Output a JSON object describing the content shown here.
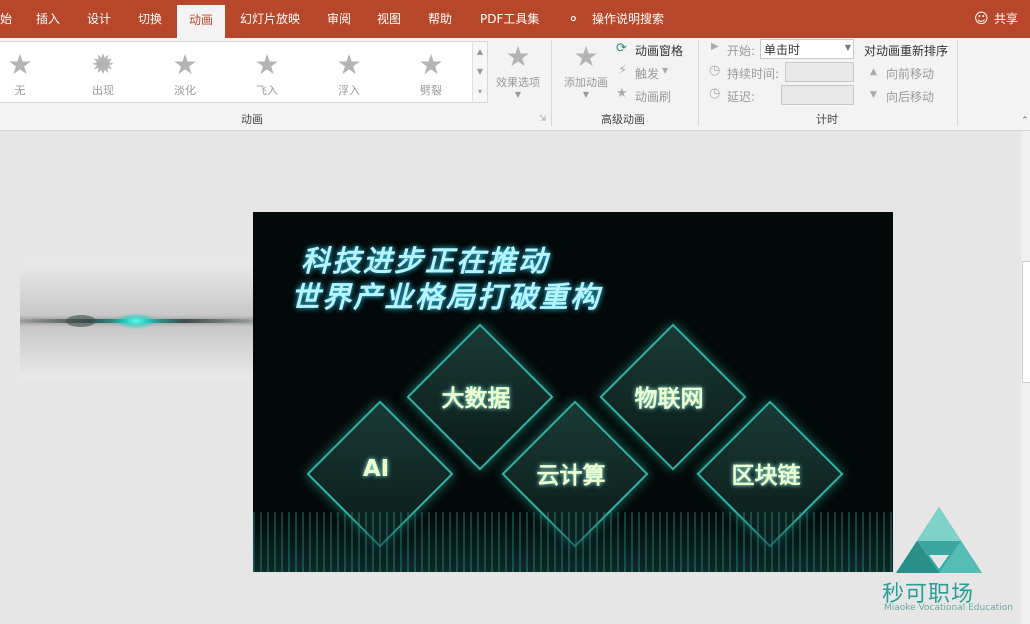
{
  "menu": {
    "items": [
      "始",
      "插入",
      "设计",
      "切换",
      "动画",
      "幻灯片放映",
      "审阅",
      "视图",
      "帮助",
      "PDF工具集"
    ],
    "active": "动画",
    "search_label": "操作说明搜索",
    "share_label": "共享"
  },
  "ribbon": {
    "gallery": [
      "无",
      "出现",
      "淡化",
      "飞入",
      "浮入",
      "劈裂"
    ],
    "effect_options": "效果选项",
    "group_animation": "动画",
    "add_animation": "添加动画",
    "animation_pane": "动画窗格",
    "trigger": "触发",
    "animation_painter": "动画刷",
    "group_advanced": "高级动画",
    "start_label": "开始:",
    "start_value": "单击时",
    "duration_label": "持续时间:",
    "delay_label": "延迟:",
    "group_timing": "计时",
    "reorder_title": "对动画重新排序",
    "move_earlier": "向前移动",
    "move_later": "向后移动"
  },
  "slide": {
    "headline_1": "科技进步正在推动",
    "headline_2": "世界产业格局打破重构",
    "tiles": [
      "大数据",
      "物联网",
      "AI",
      "云计算",
      "区块链"
    ]
  },
  "watermark": {
    "title": "秒可职场",
    "subtitle": "Miaoke Vocational Education"
  },
  "colors": {
    "accent": "#b7472a",
    "tile_border": "#2fb6aa",
    "headline_glow": "#2fd8ff"
  }
}
